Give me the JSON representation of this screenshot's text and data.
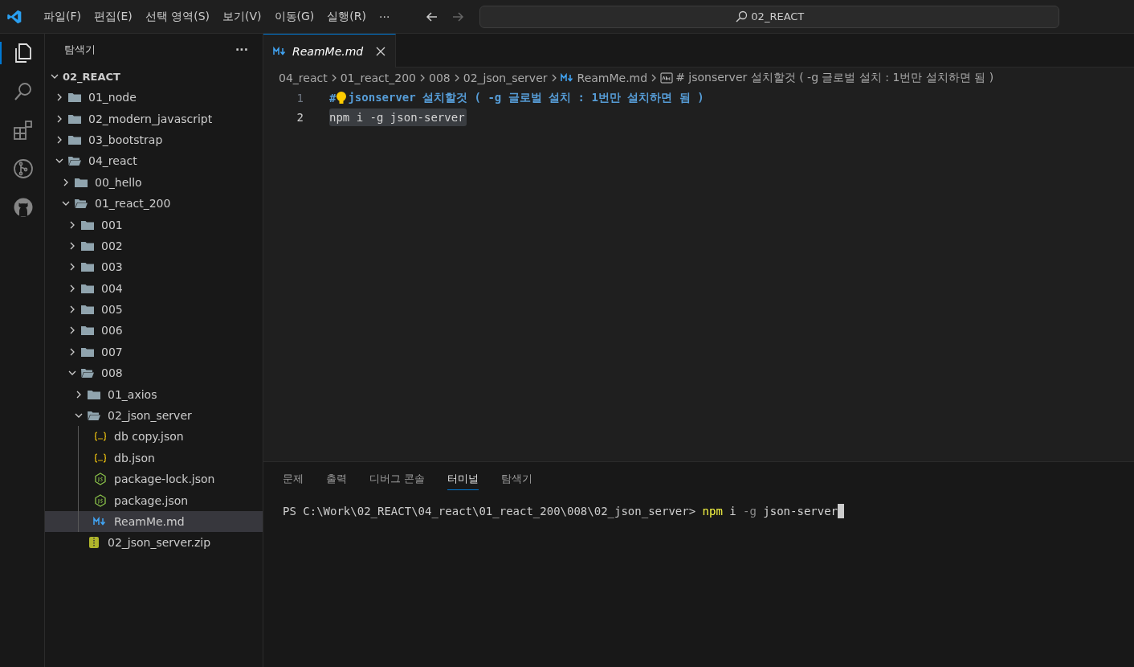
{
  "menu": [
    "파일(F)",
    "편집(E)",
    "선택 영역(S)",
    "보기(V)",
    "이동(G)",
    "실행(R)",
    "···"
  ],
  "command_center": {
    "text": "02_REACT"
  },
  "activity_bar": [
    {
      "kind": "files",
      "selected": true
    },
    {
      "kind": "search",
      "selected": false
    },
    {
      "kind": "extensions",
      "selected": false
    },
    {
      "kind": "source-control",
      "selected": false
    },
    {
      "kind": "github",
      "selected": false
    }
  ],
  "sidebar": {
    "title": "탐색기",
    "more": "···",
    "root": {
      "label": "02_REACT",
      "expanded": true
    },
    "items": [
      {
        "kind": "folder",
        "label": "01_node",
        "expanded": false,
        "selected": false
      },
      {
        "kind": "folder",
        "label": "02_modern_javascript",
        "expanded": false,
        "selected": false
      },
      {
        "kind": "folder",
        "label": "03_bootstrap",
        "expanded": false,
        "selected": false
      },
      {
        "kind": "folder",
        "label": "04_react",
        "expanded": true,
        "selected": false,
        "children": [
          {
            "kind": "folder",
            "label": "00_hello",
            "expanded": false,
            "selected": false
          },
          {
            "kind": "folder",
            "label": "01_react_200",
            "expanded": true,
            "selected": false,
            "children": [
              {
                "kind": "folder",
                "label": "001",
                "expanded": false,
                "selected": false
              },
              {
                "kind": "folder",
                "label": "002",
                "expanded": false,
                "selected": false
              },
              {
                "kind": "folder",
                "label": "003",
                "expanded": false,
                "selected": false
              },
              {
                "kind": "folder",
                "label": "004",
                "expanded": false,
                "selected": false
              },
              {
                "kind": "folder",
                "label": "005",
                "expanded": false,
                "selected": false
              },
              {
                "kind": "folder",
                "label": "006",
                "expanded": false,
                "selected": false
              },
              {
                "kind": "folder",
                "label": "007",
                "expanded": false,
                "selected": false
              },
              {
                "kind": "folder",
                "label": "008",
                "expanded": true,
                "selected": false,
                "children": [
                  {
                    "kind": "folder",
                    "label": "01_axios",
                    "expanded": false,
                    "selected": false
                  },
                  {
                    "kind": "folder",
                    "label": "02_json_server",
                    "expanded": true,
                    "selected": false,
                    "children": [
                      {
                        "kind": "json",
                        "label": "db copy.json",
                        "selected": false
                      },
                      {
                        "kind": "json",
                        "label": "db.json",
                        "selected": false
                      },
                      {
                        "kind": "node",
                        "label": "package-lock.json",
                        "selected": false
                      },
                      {
                        "kind": "node",
                        "label": "package.json",
                        "selected": false
                      },
                      {
                        "kind": "markdown",
                        "label": "ReamMe.md",
                        "selected": true
                      }
                    ]
                  },
                  {
                    "kind": "zip",
                    "label": "02_json_server.zip",
                    "selected": false
                  }
                ]
              }
            ]
          }
        ]
      }
    ]
  },
  "tabs": [
    {
      "label": "ReamMe.md",
      "selected": true
    }
  ],
  "breadcrumb": [
    {
      "kind": "folder",
      "text": "04_react"
    },
    {
      "kind": "folder",
      "text": "01_react_200"
    },
    {
      "kind": "folder",
      "text": "008"
    },
    {
      "kind": "folder",
      "text": "02_json_server"
    },
    {
      "kind": "markdown",
      "text": "ReamMe.md"
    },
    {
      "kind": "symbol",
      "text": "# jsonserver 설치할것 ( -g 글로벌 설치 : 1번만 설치하면 됨 )"
    }
  ],
  "editor": {
    "lines": [
      {
        "number": "1",
        "lightbulb": true,
        "highlighted": false,
        "tokens": [
          {
            "kind": "mark",
            "text": "#"
          },
          {
            "kind": "heading",
            "text": "jsonserver 설치할것 ( -g 글로벌 설치 : 1번만 설치하면 됨 )"
          }
        ]
      },
      {
        "number": "2",
        "lightbulb": false,
        "highlighted": true,
        "tokens": [
          {
            "kind": "plain",
            "text": "npm i -g json-server"
          }
        ]
      }
    ]
  },
  "panel": {
    "tabs": [
      {
        "label": "문제",
        "selected": false
      },
      {
        "label": "출력",
        "selected": false
      },
      {
        "label": "디버그 콘솔",
        "selected": false
      },
      {
        "label": "터미널",
        "selected": true
      },
      {
        "label": "탐색기",
        "selected": false
      }
    ],
    "terminal": {
      "prompt": "PS C:\\Work\\02_REACT\\04_react\\01_react_200\\008\\02_json_server>",
      "tokens": [
        {
          "kind": "command",
          "text": "npm"
        },
        {
          "kind": "plain",
          "text": "i"
        },
        {
          "kind": "flag",
          "text": "-g"
        },
        {
          "kind": "plain",
          "text": "json-server"
        }
      ],
      "cursor": true
    }
  }
}
